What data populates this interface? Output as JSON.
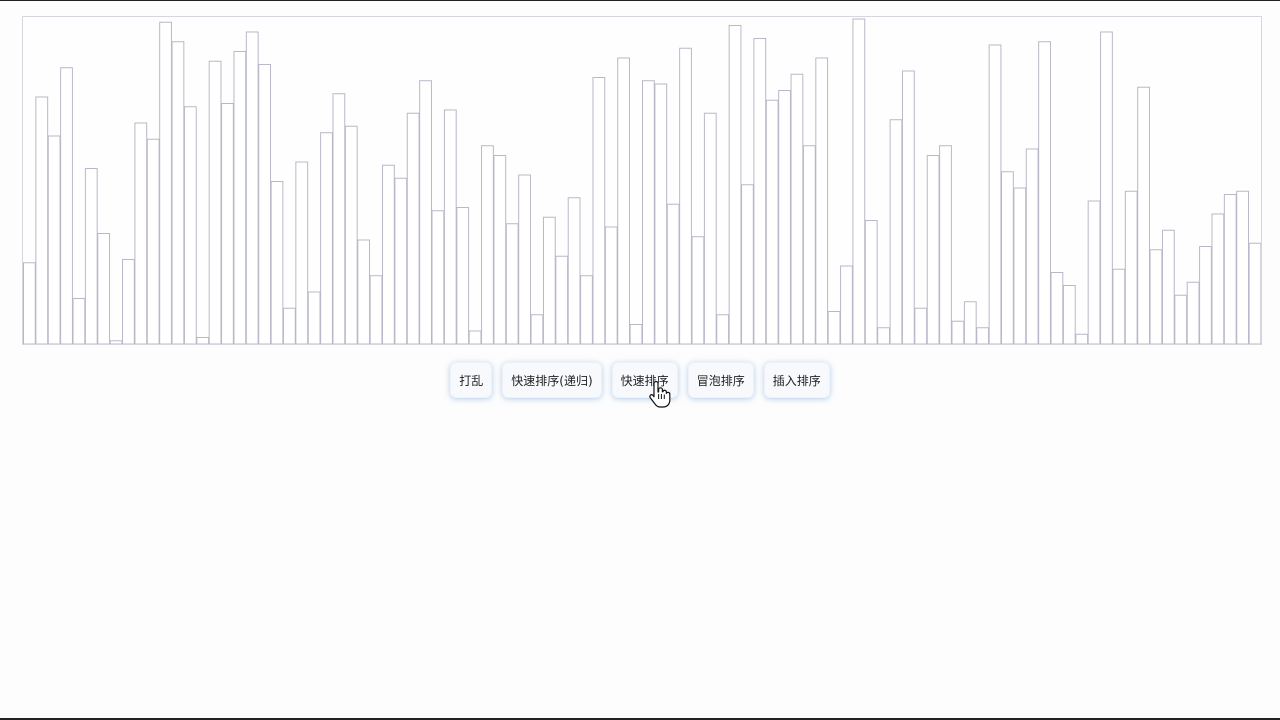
{
  "toolbar": {
    "shuffle_label": "打乱",
    "quicksort_recursive_label": "快速排序(递归)",
    "quicksort_label": "快速排序",
    "bubble_sort_label": "冒泡排序",
    "insertion_sort_label": "插入排序"
  },
  "colors": {
    "bar_stroke": "#b8b8c8",
    "bar_fill": "#ffffff",
    "button_glow": "#8fbfe6"
  },
  "icons": {
    "cursor": "pointing-hand-cursor-icon"
  },
  "chart_data": {
    "type": "bar",
    "ylim": [
      0,
      100
    ],
    "values": [
      25,
      76,
      64,
      85,
      14,
      54,
      34,
      1,
      26,
      68,
      63,
      99,
      93,
      73,
      2,
      87,
      74,
      90,
      96,
      86,
      50,
      11,
      56,
      16,
      65,
      77,
      67,
      32,
      21,
      55,
      51,
      71,
      81,
      41,
      72,
      42,
      4,
      61,
      58,
      37,
      52,
      9,
      39,
      27,
      45,
      21,
      82,
      36,
      88,
      6,
      81,
      80,
      43,
      91,
      33,
      71,
      9,
      98,
      49,
      94,
      75,
      78,
      83,
      61,
      88,
      10,
      24,
      100,
      38,
      5,
      69,
      84,
      11,
      58,
      61,
      7,
      13,
      5,
      92,
      53,
      48,
      60,
      93,
      22,
      18,
      3,
      44,
      96,
      23,
      47,
      79,
      29,
      35,
      15,
      19,
      30,
      40,
      46,
      47,
      31
    ]
  }
}
